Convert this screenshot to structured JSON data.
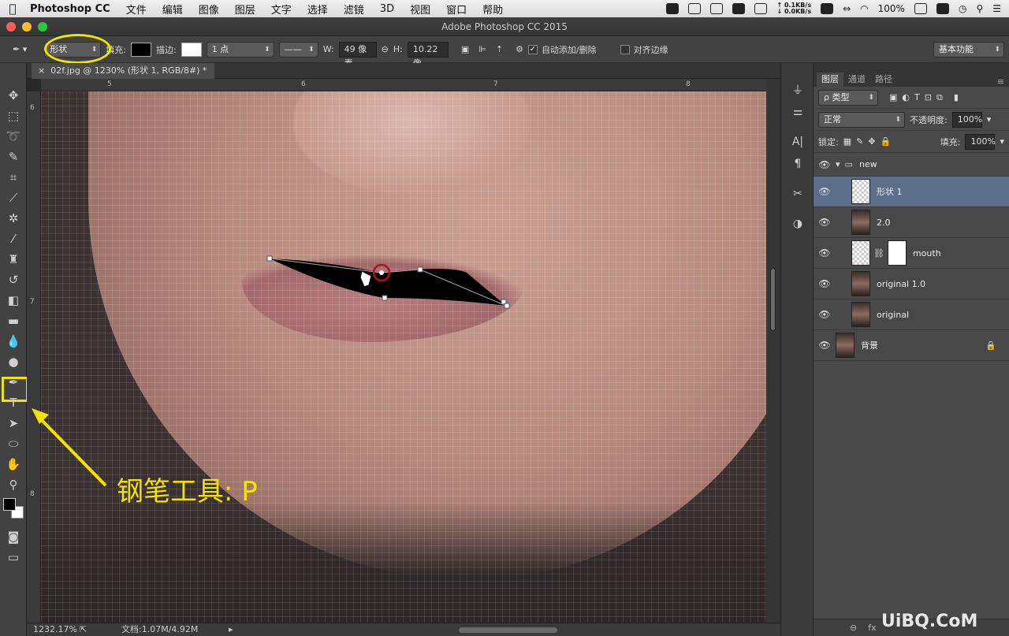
{
  "menubar": {
    "apple": "",
    "app": "Photoshop CC",
    "items": [
      "文件",
      "编辑",
      "图像",
      "图层",
      "文字",
      "选择",
      "滤镜",
      "3D",
      "视图",
      "窗口",
      "帮助"
    ],
    "net_up": "0.1KB/s",
    "net_down": "0.0KB/s",
    "battery": "100%"
  },
  "titlebar": {
    "title": "Adobe Photoshop CC 2015"
  },
  "options": {
    "mode": "形状",
    "fill_label": "填充:",
    "stroke_label": "描边:",
    "stroke_width": "1 点",
    "w_label": "W:",
    "w_value": "49 像素",
    "h_label": "H:",
    "h_value": "10.22 像",
    "auto_add": "自动添加/删除",
    "align_edges": "对齐边缘",
    "workspace": "基本功能"
  },
  "document": {
    "tab": "02f.jpg @ 1230% (形状 1, RGB/8#) *"
  },
  "rulers": {
    "top": [
      "5",
      "6",
      "7",
      "8"
    ],
    "left": [
      "6",
      "7",
      "8"
    ]
  },
  "status": {
    "zoom": "1232.17%",
    "doc": "文档:1.07M/4.92M"
  },
  "layers_panel": {
    "tabs": [
      "图层",
      "通道",
      "路径"
    ],
    "filter": "ρ 类型",
    "blend": "正常",
    "opacity_label": "不透明度:",
    "opacity": "100%",
    "lock_label": "锁定:",
    "fill_label": "填充:",
    "fill": "100%",
    "layers": [
      {
        "name": "new",
        "type": "group"
      },
      {
        "name": "形状 1",
        "type": "shape"
      },
      {
        "name": "2.0",
        "type": "photo"
      },
      {
        "name": "mouth",
        "type": "mask"
      },
      {
        "name": "original 1.0",
        "type": "photo"
      },
      {
        "name": "original",
        "type": "photo"
      },
      {
        "name": "背景",
        "type": "background"
      }
    ]
  },
  "annotation": {
    "text": "钢笔工具: P"
  },
  "watermark": {
    "text": "UiBQ.CoM"
  },
  "colors": {
    "annotation": "#f2e400",
    "selection": "#5b6e8a"
  }
}
